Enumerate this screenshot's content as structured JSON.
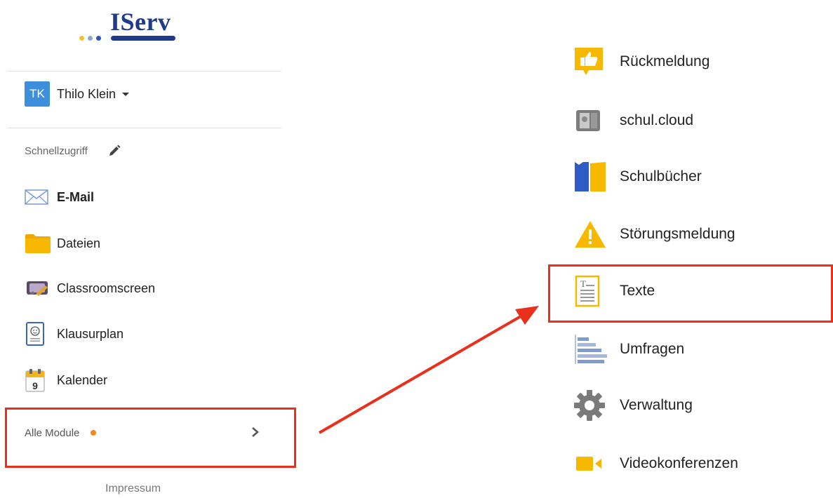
{
  "logo": {
    "text": "IServ"
  },
  "user": {
    "initials": "TK",
    "name": "Thilo Klein"
  },
  "quick_access": {
    "label": "Schnellzugriff"
  },
  "quick_items": [
    {
      "label": "E-Mail",
      "icon": "mail-icon"
    },
    {
      "label": "Dateien",
      "icon": "folder-icon"
    },
    {
      "label": "Classroomscreen",
      "icon": "classroomscreen-icon"
    },
    {
      "label": "Klausurplan",
      "icon": "exam-plan-icon"
    },
    {
      "label": "Kalender",
      "icon": "calendar-icon",
      "day": "9"
    }
  ],
  "all_modules": {
    "label": "Alle Module"
  },
  "footer": {
    "impressum": "Impressum"
  },
  "modules": [
    {
      "label": "Rückmeldung",
      "icon": "feedback-icon"
    },
    {
      "label": "schul.cloud",
      "icon": "schulcloud-icon"
    },
    {
      "label": "Schulbücher",
      "icon": "schoolbooks-icon"
    },
    {
      "label": "Störungsmeldung",
      "icon": "warning-icon"
    },
    {
      "label": "Texte",
      "icon": "text-document-icon"
    },
    {
      "label": "Umfragen",
      "icon": "survey-icon"
    },
    {
      "label": "Verwaltung",
      "icon": "gear-icon"
    },
    {
      "label": "Videokonferenzen",
      "icon": "video-camera-icon"
    }
  ],
  "colors": {
    "brand": "#1f3a8a",
    "avatar": "#3d8fdc",
    "highlight": "#e8301c",
    "badge": "#f08a1c"
  }
}
